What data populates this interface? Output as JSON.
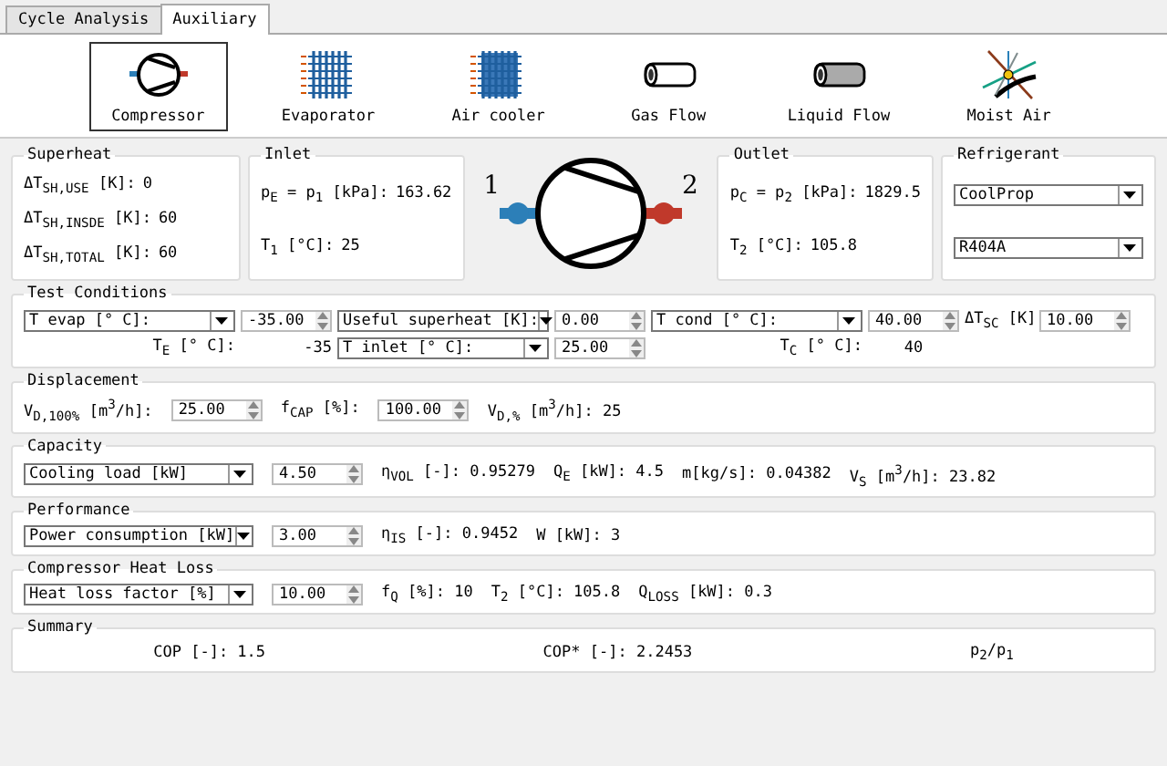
{
  "tabs": [
    {
      "label": "Cycle Analysis",
      "selected": false
    },
    {
      "label": "Auxiliary",
      "selected": true
    }
  ],
  "toolbar": [
    {
      "kind": "compressor",
      "label": "Compressor",
      "selected": true
    },
    {
      "kind": "evaporator",
      "label": "Evaporator",
      "selected": false
    },
    {
      "kind": "air-cooler",
      "label": "Air cooler",
      "selected": false
    },
    {
      "kind": "gas-flow",
      "label": "Gas Flow",
      "selected": false
    },
    {
      "kind": "liquid-flow",
      "label": "Liquid Flow",
      "selected": false
    },
    {
      "kind": "moist-air",
      "label": "Moist Air",
      "selected": false
    }
  ],
  "superheat": {
    "title": "Superheat",
    "rows": [
      {
        "label": "ΔT$_{SH,USE}$ [K]:",
        "value": "0"
      },
      {
        "label": "ΔT$_{SH,INSDE}$ [K]:",
        "value": "60"
      },
      {
        "label": "ΔT$_{SH,TOTAL}$ [K]:",
        "value": "60"
      }
    ]
  },
  "inlet": {
    "title": "Inlet",
    "rows": [
      {
        "label": "p$_{E}$ = p$_{1}$ [kPa]:",
        "value": "163.62"
      },
      {
        "label": "T$_{1}$ [°C]:",
        "value": "25"
      }
    ]
  },
  "diagram": {
    "inlet_label": "1",
    "outlet_label": "2"
  },
  "outlet": {
    "title": "Outlet",
    "rows": [
      {
        "label": "p$_{C}$ = p$_{2}$ [kPa]:",
        "value": "1829.5"
      },
      {
        "label": "T$_{2}$ [°C]:",
        "value": "105.8"
      }
    ]
  },
  "refrigerant": {
    "title": "Refrigerant",
    "selects": [
      "CoolProp",
      "R404A"
    ]
  },
  "test_conditions": {
    "title": "Test Conditions",
    "rows": [
      [
        {
          "kind": "select",
          "text": "T evap [° C]:"
        },
        {
          "kind": "spin",
          "text": "-35.00"
        },
        {
          "kind": "select",
          "text": "Useful superheat [K]:"
        },
        {
          "kind": "spin",
          "text": "0.00"
        },
        {
          "kind": "select",
          "text": "T cond [° C]:"
        },
        {
          "kind": "spin",
          "text": "40.00"
        },
        {
          "kind": "label",
          "text": "ΔT$_{SC}$ [K]"
        },
        {
          "kind": "spin",
          "text": "10.00"
        }
      ],
      [
        {
          "kind": "label",
          "text": "T$_{E}$ [° C]:"
        },
        {
          "kind": "value",
          "text": "-35"
        },
        {
          "kind": "select",
          "text": "T inlet [° C]:"
        },
        {
          "kind": "spin",
          "text": "25.00"
        },
        {
          "kind": "label",
          "text": "T$_{C}$ [° C]:"
        },
        {
          "kind": "value",
          "text": "40"
        }
      ]
    ]
  },
  "sections": [
    {
      "title": "Displacement",
      "items": [
        {
          "kind": "label",
          "text": "V$_{D,100%}$ [m$^{3}$/h]:"
        },
        {
          "kind": "spin",
          "text": "25.00"
        },
        {
          "kind": "label",
          "text": "f$_{CAP}$ [%]:"
        },
        {
          "kind": "spin",
          "text": "100.00"
        },
        {
          "kind": "label",
          "text": "V$_{D,%}$ [m$^{3}$/h]: 25"
        }
      ]
    },
    {
      "title": "Capacity",
      "items": [
        {
          "kind": "select",
          "text": "Cooling load [kW]"
        },
        {
          "kind": "spin",
          "text": "4.50"
        },
        {
          "kind": "label",
          "text": "η$_{VOL}$ [-]: 0.95279"
        },
        {
          "kind": "label",
          "text": "Q$_{E}$ [kW]: 4.5"
        },
        {
          "kind": "label",
          "text": "m[kg/s]: 0.04382"
        },
        {
          "kind": "label",
          "text": "V$_{S}$ [m$^{3}$/h]: 23.82"
        }
      ]
    },
    {
      "title": "Performance",
      "items": [
        {
          "kind": "select",
          "text": "Power consumption [kW]"
        },
        {
          "kind": "spin",
          "text": "3.00"
        },
        {
          "kind": "label",
          "text": "η$_{IS}$ [-]: 0.9452"
        },
        {
          "kind": "label",
          "text": "W [kW]: 3"
        }
      ]
    },
    {
      "title": "Compressor Heat Loss",
      "items": [
        {
          "kind": "select",
          "text": "Heat loss factor [%]"
        },
        {
          "kind": "spin",
          "text": "10.00"
        },
        {
          "kind": "label",
          "text": "f$_{Q}$ [%]: 10"
        },
        {
          "kind": "label",
          "text": "T$_{2}$ [°C]: 105.8"
        },
        {
          "kind": "label",
          "text": "Q$_{LOSS}$ [kW]: 0.3"
        }
      ]
    },
    {
      "title": "Summary",
      "items": [
        {
          "kind": "result",
          "text": "COP [-]: 1.5"
        },
        {
          "kind": "result",
          "text": "COP* [-]: 2.2453"
        },
        {
          "kind": "result",
          "text": "p$_{2}$/p$_{1}$"
        }
      ]
    }
  ]
}
